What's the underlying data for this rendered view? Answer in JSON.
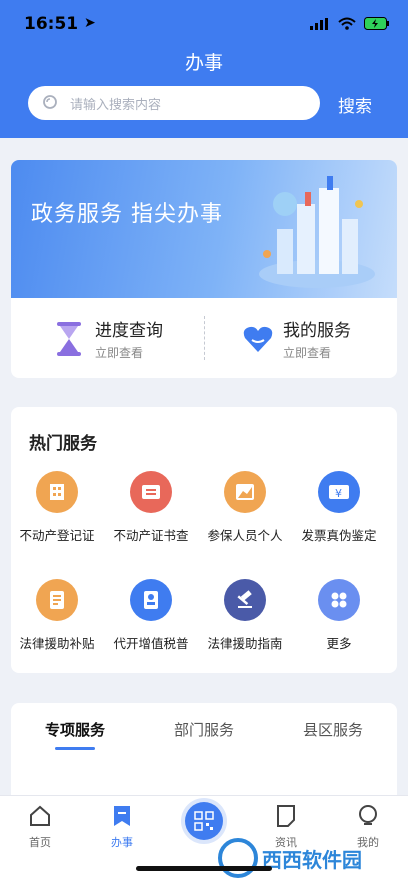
{
  "status_bar": {
    "time": "16:51"
  },
  "header": {
    "title": "办事",
    "search_placeholder": "请输入搜索内容",
    "search_button": "搜索"
  },
  "banner": {
    "text": "政务服务  指尖办事"
  },
  "quick": [
    {
      "title": "进度查询",
      "subtitle": "立即查看",
      "icon": "hourglass-icon",
      "color": "#8a6fe0"
    },
    {
      "title": "我的服务",
      "subtitle": "立即查看",
      "icon": "heart-icon",
      "color": "#3f7cf0"
    }
  ],
  "hot": {
    "title": "热门服务",
    "items": [
      {
        "label": "不动产登记证",
        "icon": "building-icon",
        "color": "#f0a552"
      },
      {
        "label": "不动产证书查",
        "icon": "certificate-icon",
        "color": "#e8685a"
      },
      {
        "label": "参保人员个人",
        "icon": "chart-icon",
        "color": "#f0a552"
      },
      {
        "label": "发票真伪鉴定",
        "icon": "invoice-icon",
        "color": "#3f7cf0"
      },
      {
        "label": "法律援助补贴",
        "icon": "document-icon",
        "color": "#f0a552"
      },
      {
        "label": "代开增值税普",
        "icon": "id-card-icon",
        "color": "#3f7cf0"
      },
      {
        "label": "法律援助指南",
        "icon": "gavel-icon",
        "color": "#4a5aa8"
      },
      {
        "label": "更多",
        "icon": "more-icon",
        "color": "#6a8ff0"
      }
    ]
  },
  "tabs": [
    "专项服务",
    "部门服务",
    "县区服务"
  ],
  "nav": [
    {
      "label": "首页",
      "icon": "home-icon"
    },
    {
      "label": "办事",
      "icon": "bookmark-icon"
    },
    {
      "label": "",
      "icon": "qr-code-icon"
    },
    {
      "label": "资讯",
      "icon": "note-icon"
    },
    {
      "label": "我的",
      "icon": "user-icon"
    }
  ],
  "watermark": {
    "text": "西西软件园"
  }
}
